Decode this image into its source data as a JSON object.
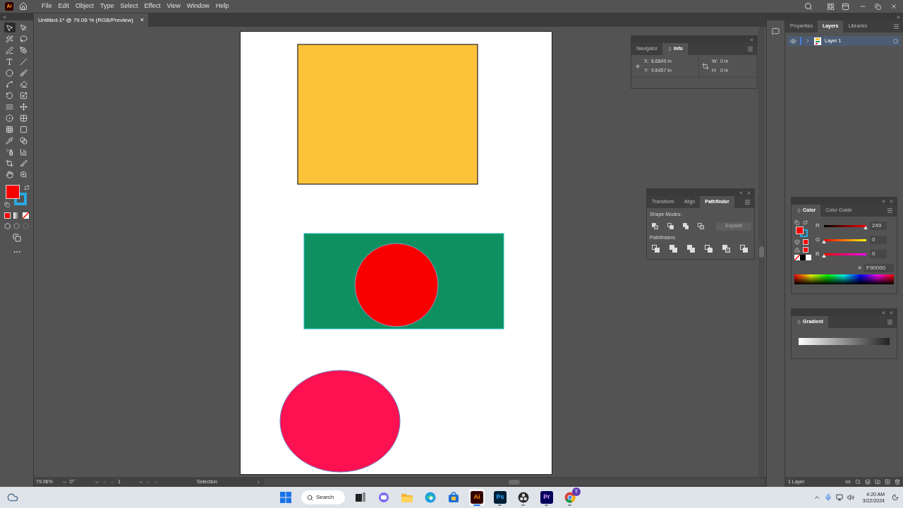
{
  "menu_bar": {
    "app_badge": "Ai",
    "items": [
      "File",
      "Edit",
      "Object",
      "Type",
      "Select",
      "Effect",
      "View",
      "Window",
      "Help"
    ]
  },
  "document_tab": {
    "title": "Untitled-1* @ 79.06 % (RGB/Preview)",
    "close": "×"
  },
  "tools": [
    {
      "selected": true
    },
    {
      "selected": false
    },
    {
      "selected": false
    },
    {
      "selected": false
    },
    {
      "selected": false
    },
    {
      "selected": false
    },
    {
      "selected": false
    },
    {
      "selected": false
    },
    {
      "selected": false
    },
    {
      "selected": false
    },
    {
      "selected": false
    },
    {
      "selected": false
    },
    {
      "selected": false
    },
    {
      "selected": false
    },
    {
      "selected": false
    },
    {
      "selected": false
    },
    {
      "selected": false
    },
    {
      "selected": false
    },
    {
      "selected": false
    },
    {
      "selected": false
    },
    {
      "selected": false
    },
    {
      "selected": false
    },
    {
      "selected": false
    },
    {
      "selected": false
    },
    {
      "selected": false
    },
    {
      "selected": false
    },
    {
      "selected": false
    },
    {
      "selected": false
    }
  ],
  "info_panel": {
    "tabs": [
      {
        "label": "Navigator",
        "selected": false
      },
      {
        "label": "Info",
        "selected": true
      }
    ],
    "x_label": "X:",
    "x": "8.6849 in",
    "y_label": "Y:",
    "y": "9.8457 in",
    "w_label": "W:",
    "w": "0 in",
    "h_label": "H:",
    "h": "0 in"
  },
  "pathfinder_panel": {
    "tabs": [
      {
        "label": "Transform",
        "selected": false
      },
      {
        "label": "Align",
        "selected": false
      },
      {
        "label": "Pathfinder",
        "selected": true
      }
    ],
    "shape_modes_label": "Shape Modes:",
    "expand_button": {
      "label": "Expand",
      "disabled": true
    },
    "pathfinders_label": "Pathfinders:"
  },
  "layers_panel": {
    "tabs": [
      {
        "label": "Properties",
        "selected": false
      },
      {
        "label": "Layers",
        "selected": true
      },
      {
        "label": "Libraries",
        "selected": false
      }
    ],
    "layers": [
      {
        "name": "Layer 1",
        "visible": true,
        "selected": true
      }
    ],
    "footer": "1 Layer"
  },
  "color_panel": {
    "tabs": [
      {
        "label": "Color",
        "selected": true
      },
      {
        "label": "Color Guide",
        "selected": false
      }
    ],
    "sliders": [
      {
        "label": "R",
        "level": 0.98,
        "value": "249"
      },
      {
        "label": "G",
        "level": 0,
        "value": "0"
      },
      {
        "label": "B",
        "level": 0,
        "value": "0"
      }
    ],
    "hex_label": "#",
    "hex": "F90000"
  },
  "gradient_panel": {
    "tabs": [
      {
        "label": "Gradient",
        "selected": true
      }
    ]
  },
  "status_bar": {
    "zoom": "79.06%",
    "rotation": "0°",
    "artboard": "1",
    "tool": "Selection"
  },
  "taskbar": {
    "search": "Search",
    "apps": [
      {
        "kind": "start",
        "running": false,
        "selected": false
      },
      {
        "kind": "taskview",
        "running": false,
        "selected": false
      },
      {
        "kind": "teams",
        "running": false,
        "selected": false
      },
      {
        "kind": "explorer",
        "running": false,
        "selected": false
      },
      {
        "kind": "edge",
        "running": false,
        "selected": false
      },
      {
        "kind": "store",
        "running": false,
        "selected": false
      },
      {
        "kind": "ai",
        "label": "Ai",
        "running": true,
        "selected": true
      },
      {
        "kind": "ps",
        "label": "Ps",
        "running": true,
        "selected": false
      },
      {
        "kind": "obs",
        "running": true,
        "selected": false
      },
      {
        "kind": "pr",
        "label": "Pr",
        "running": true,
        "selected": false
      },
      {
        "kind": "chrome",
        "badge": "T",
        "running": true,
        "selected": false
      }
    ],
    "time": "4:20 AM",
    "date": "3/22/2024"
  }
}
